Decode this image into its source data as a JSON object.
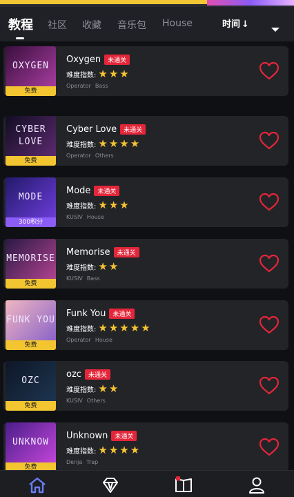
{
  "tabs": {
    "items": [
      {
        "label": "教程",
        "active": true
      },
      {
        "label": "社区",
        "active": false
      },
      {
        "label": "收藏",
        "active": false
      },
      {
        "label": "音乐包",
        "active": false
      },
      {
        "label": "House",
        "active": false
      }
    ],
    "sort_label": "时间",
    "sort_arrow": "↓"
  },
  "difficulty_label": "难度指数:",
  "songs": [
    {
      "title": "Oxygen",
      "status": "未通关",
      "stars": 3,
      "artist": "Operator",
      "genre": "Bass",
      "price": "免费",
      "cover_text": "OXYGEN",
      "colors": [
        "#3a0f3d",
        "#a53c9e"
      ]
    },
    {
      "title": "Cyber Love",
      "status": "未通关",
      "stars": 4,
      "artist": "Operator",
      "genre": "Others",
      "price": "免费",
      "cover_text": "CYBER LOVE",
      "colors": [
        "#120d22",
        "#5b2a6e"
      ]
    },
    {
      "title": "Mode",
      "status": "未通关",
      "stars": 3,
      "artist": "KUSIV",
      "genre": "House",
      "price": "300积分",
      "cover_text": "MODE",
      "colors": [
        "#231a6b",
        "#6a3bd6"
      ]
    },
    {
      "title": "Memorise",
      "status": "未通关",
      "stars": 2,
      "artist": "KUSIV",
      "genre": "Bass",
      "price": "免费",
      "cover_text": "MEMORISE",
      "colors": [
        "#2a1a45",
        "#b0428f"
      ]
    },
    {
      "title": "Funk You",
      "status": "未通关",
      "stars": 5,
      "artist": "Operator",
      "genre": "House",
      "price": "免费",
      "cover_text": "FUNK YOU",
      "colors": [
        "#f1b6c2",
        "#8a64c8"
      ]
    },
    {
      "title": "ozc",
      "status": "未通关",
      "stars": 2,
      "artist": "KUSIV",
      "genre": "Others",
      "price": "免费",
      "cover_text": "OZC",
      "colors": [
        "#0e1626",
        "#1d3550"
      ]
    },
    {
      "title": "Unknown",
      "status": "未通关",
      "stars": 4,
      "artist": "Denja",
      "genre": "Trap",
      "price": "免费",
      "cover_text": "UNKNOW",
      "colors": [
        "#4b1e8a",
        "#c145d8"
      ]
    }
  ],
  "bottom_nav": [
    {
      "icon": "home-icon",
      "active": true
    },
    {
      "icon": "diamond-icon",
      "active": false
    },
    {
      "icon": "book-icon",
      "active": false,
      "badge": true
    },
    {
      "icon": "user-icon",
      "active": false
    }
  ],
  "colors": {
    "accent": "#e4263a",
    "star": "#f5c431",
    "price_free": "#f2c531",
    "price_paid": "#8b5cf6",
    "nav_active": "#6b7cf5"
  }
}
